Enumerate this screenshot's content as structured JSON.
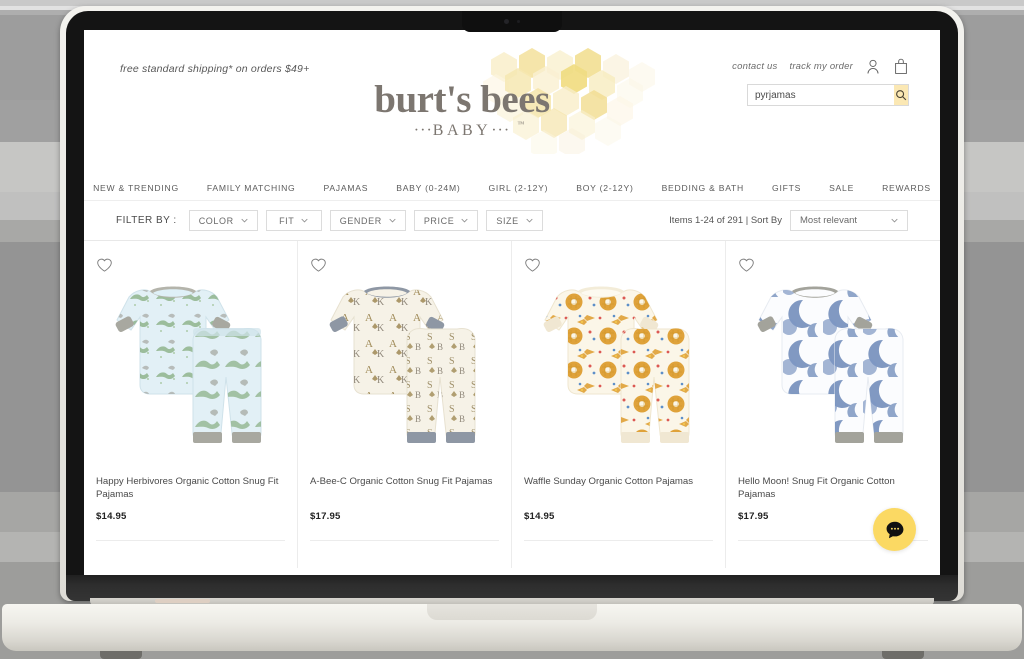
{
  "site": {
    "promo": "free standard shipping* on orders $49+",
    "brand_main": "burt's bees",
    "brand_sub": "BABY",
    "brand_tm": "™"
  },
  "utility": {
    "contact": "contact us",
    "track": "track my order",
    "account_icon": "person-icon",
    "cart_icon": "shopping-bag-icon",
    "search_icon": "search-icon"
  },
  "search": {
    "value": "pyrjamas",
    "placeholder": "Search"
  },
  "nav": {
    "items": [
      {
        "label": "NEW & TRENDING"
      },
      {
        "label": "FAMILY MATCHING"
      },
      {
        "label": "PAJAMAS"
      },
      {
        "label": "BABY (0-24M)"
      },
      {
        "label": "GIRL (2-12Y)"
      },
      {
        "label": "BOY (2-12Y)"
      },
      {
        "label": "BEDDING & BATH"
      },
      {
        "label": "GIFTS"
      },
      {
        "label": "SALE"
      },
      {
        "label": "REWARDS"
      }
    ]
  },
  "filters": {
    "label": "FILTER BY :",
    "pills": [
      {
        "label": "COLOR"
      },
      {
        "label": "FIT"
      },
      {
        "label": "GENDER"
      },
      {
        "label": "PRICE"
      },
      {
        "label": "SIZE"
      }
    ],
    "count_text": "Items 1-24 of 291  |  Sort By",
    "sort_value": "Most relevant"
  },
  "products": [
    {
      "name": "Happy Herbivores Organic Cotton Snug Fit Pajamas",
      "price": "$14.95",
      "pattern": "dinosaurs",
      "fabric_color": "#e2f0f6",
      "accent_color": "#7a9c6c",
      "trim_color": "#a9a9a2"
    },
    {
      "name": "A-Bee-C Organic Cotton Snug Fit Pajamas",
      "price": "$17.95",
      "pattern": "letters-bees",
      "fabric_color": "#f6f2e7",
      "accent_color": "#a08a55",
      "trim_color": "#8e97a4"
    },
    {
      "name": "Waffle Sunday Organic Cotton Pajamas",
      "price": "$14.95",
      "pattern": "waffles",
      "fabric_color": "#fbf6e8",
      "accent_color": "#dd9b2b",
      "trim_color": "#f0e7d2"
    },
    {
      "name": "Hello Moon! Snug Fit Organic Cotton Pajamas",
      "price": "$17.95",
      "pattern": "moons",
      "fabric_color": "#fbfcfe",
      "accent_color": "#5c7cb0",
      "trim_color": "#a3a39b"
    }
  ],
  "chat": {
    "icon": "chat-bubble-icon",
    "color": "#fbd963"
  },
  "colors": {
    "brand_text": "#7c7670",
    "honeycomb": "#f3dd8e",
    "search_button": "#fbe8b4"
  }
}
